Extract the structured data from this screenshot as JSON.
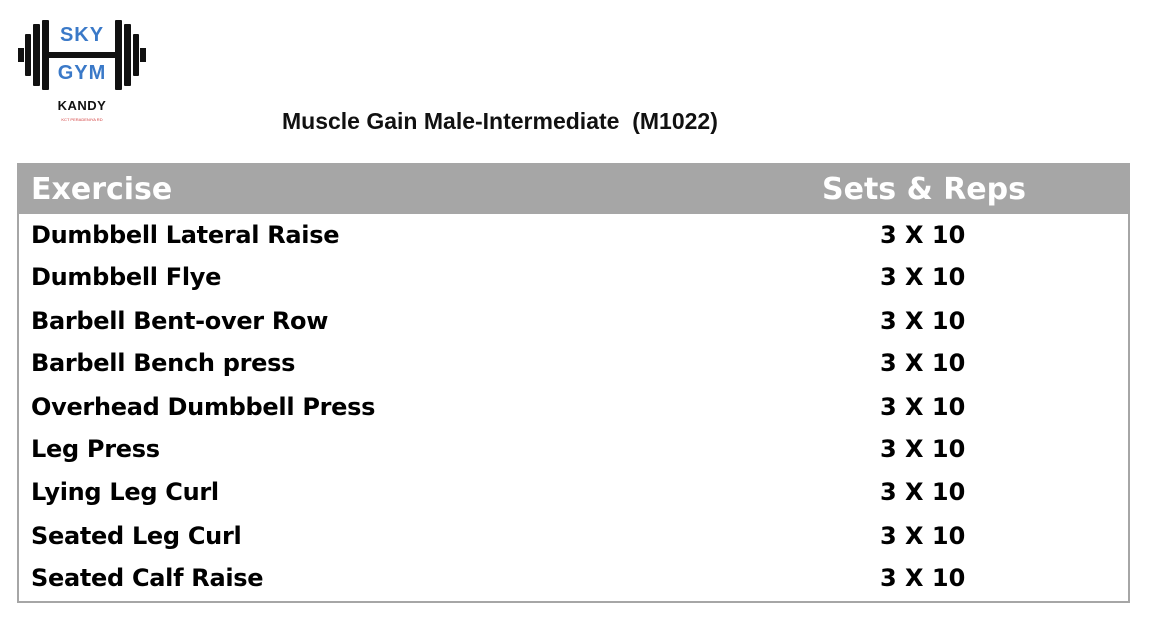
{
  "logo": {
    "word_top": "SKY",
    "word_bottom": "GYM",
    "city": "KANDY",
    "tagline": "KCT PERADENIYA RD",
    "accent_color": "#3a79c8",
    "icon": "barbell-icon"
  },
  "title": "Muscle Gain Male-Intermediate  (M1022)",
  "table": {
    "columns": [
      "Exercise",
      "Sets & Reps"
    ],
    "header_color": "#a6a6a6",
    "rows": [
      {
        "exercise": "Dumbbell Lateral Raise",
        "sets_reps": "3 X 10"
      },
      {
        "exercise": "Dumbbell Flye",
        "sets_reps": "3 X 10"
      },
      {
        "exercise": "Barbell Bent-over Row",
        "sets_reps": "3 X 10"
      },
      {
        "exercise": "Barbell Bench press",
        "sets_reps": "3 X 10"
      },
      {
        "exercise": "Overhead Dumbbell Press",
        "sets_reps": "3 X 10"
      },
      {
        "exercise": "Leg Press",
        "sets_reps": "3 X 10"
      },
      {
        "exercise": "Lying Leg Curl",
        "sets_reps": "3 X 10"
      },
      {
        "exercise": "Seated Leg Curl",
        "sets_reps": "3 X 10"
      },
      {
        "exercise": "Seated Calf Raise",
        "sets_reps": "3 X 10"
      }
    ]
  }
}
